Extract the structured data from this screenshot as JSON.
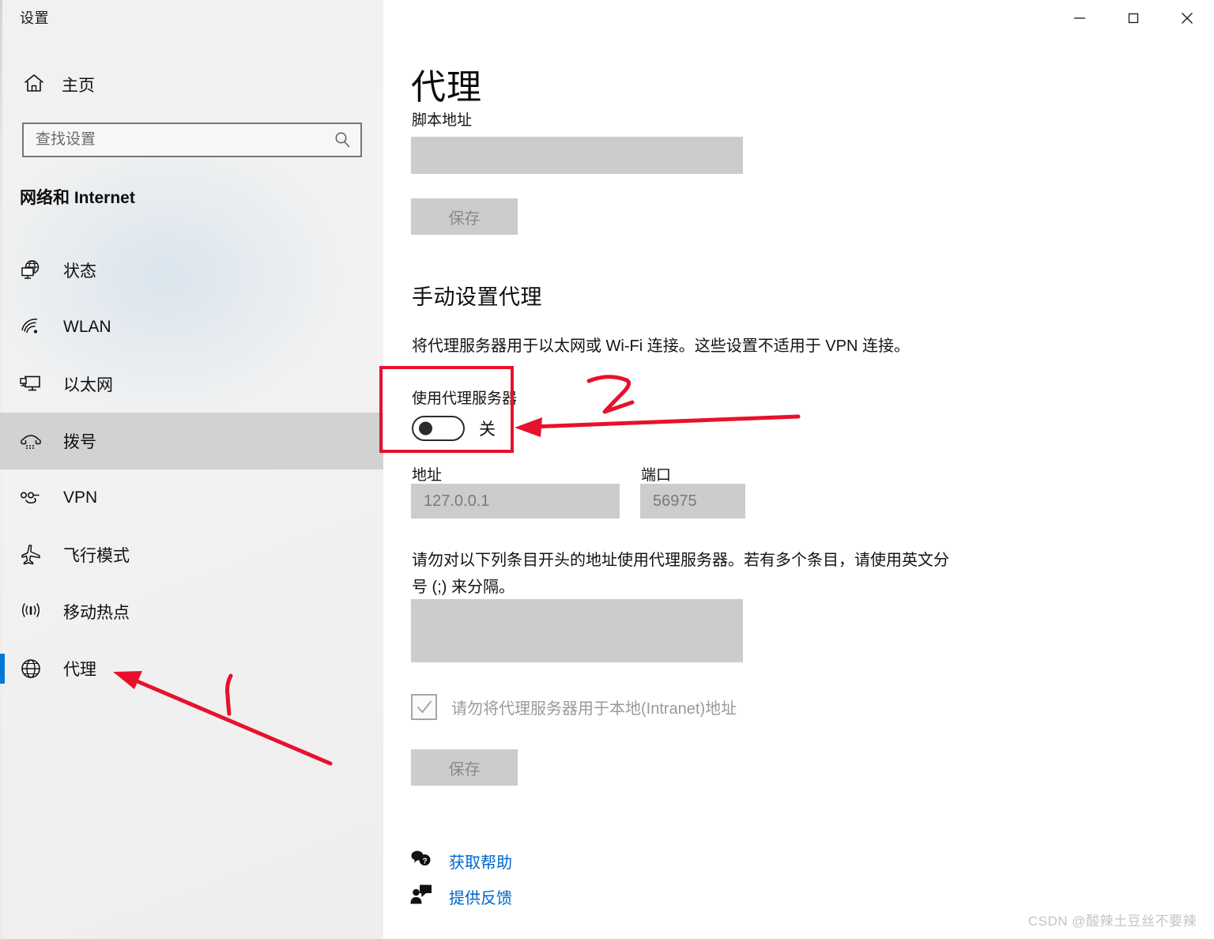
{
  "window": {
    "app_title": "设置",
    "controls": [
      {
        "name": "minimize",
        "glyph": "minimize-icon"
      },
      {
        "name": "maximize",
        "glyph": "maximize-icon"
      },
      {
        "name": "close",
        "glyph": "close-icon"
      }
    ]
  },
  "sidebar": {
    "home_label": "主页",
    "home_icon": "home-icon",
    "search": {
      "placeholder": "查找设置",
      "value": "",
      "icon": "search-icon"
    },
    "group_title": "网络和 Internet",
    "items": [
      {
        "label": "状态",
        "icon": "globe-monitor-icon",
        "state": "normal"
      },
      {
        "label": "WLAN",
        "icon": "wifi-icon",
        "state": "normal"
      },
      {
        "label": "以太网",
        "icon": "ethernet-icon",
        "state": "normal"
      },
      {
        "label": "拨号",
        "icon": "dialup-phone-icon",
        "state": "hovered"
      },
      {
        "label": "VPN",
        "icon": "vpn-icon",
        "state": "normal"
      },
      {
        "label": "飞行模式",
        "icon": "airplane-icon",
        "state": "normal"
      },
      {
        "label": "移动热点",
        "icon": "hotspot-icon",
        "state": "normal"
      },
      {
        "label": "代理",
        "icon": "globe-icon",
        "state": "selected"
      }
    ],
    "accent_color": "#0078d7",
    "hover_color": "#d2d2d2"
  },
  "main": {
    "page_title": "代理",
    "script_address": {
      "label": "脚本地址",
      "value": "",
      "disabled": true
    },
    "save_top": {
      "label": "保存",
      "disabled": true
    },
    "manual_section": {
      "heading": "手动设置代理",
      "description": "将代理服务器用于以太网或 Wi-Fi 连接。这些设置不适用于 VPN 连接。",
      "toggle": {
        "label": "使用代理服务器",
        "state_text": "关",
        "checked": false
      },
      "address": {
        "label": "地址",
        "value": "127.0.0.1",
        "disabled": true
      },
      "port": {
        "label": "端口",
        "value": "56975",
        "disabled": true
      },
      "exceptions": {
        "description": "请勿对以下列条目开头的地址使用代理服务器。若有多个条目，请使用英文分号 (;) 来分隔。",
        "value": "",
        "disabled": true
      },
      "bypass_local": {
        "label": "请勿将代理服务器用于本地(Intranet)地址",
        "checked": true,
        "disabled": true
      },
      "save_bottom": {
        "label": "保存",
        "disabled": true
      }
    },
    "footer_links": [
      {
        "label": "获取帮助",
        "icon": "help-bubble-icon",
        "color": "#0066cc"
      },
      {
        "label": "提供反馈",
        "icon": "feedback-person-icon",
        "color": "#0066cc"
      }
    ]
  },
  "annotations": {
    "color": "#e8112d",
    "marks": [
      {
        "name": "callout-box-proxy-toggle",
        "type": "rectangle"
      },
      {
        "name": "callout-arrow-to-toggle",
        "type": "arrow"
      },
      {
        "name": "callout-number-2",
        "type": "handwritten-number",
        "text": "2"
      },
      {
        "name": "callout-arrow-to-proxy-nav",
        "type": "arrow"
      },
      {
        "name": "callout-number-1",
        "type": "handwritten-number",
        "text": "1"
      }
    ]
  },
  "watermark": "CSDN @酸辣土豆丝不要辣"
}
